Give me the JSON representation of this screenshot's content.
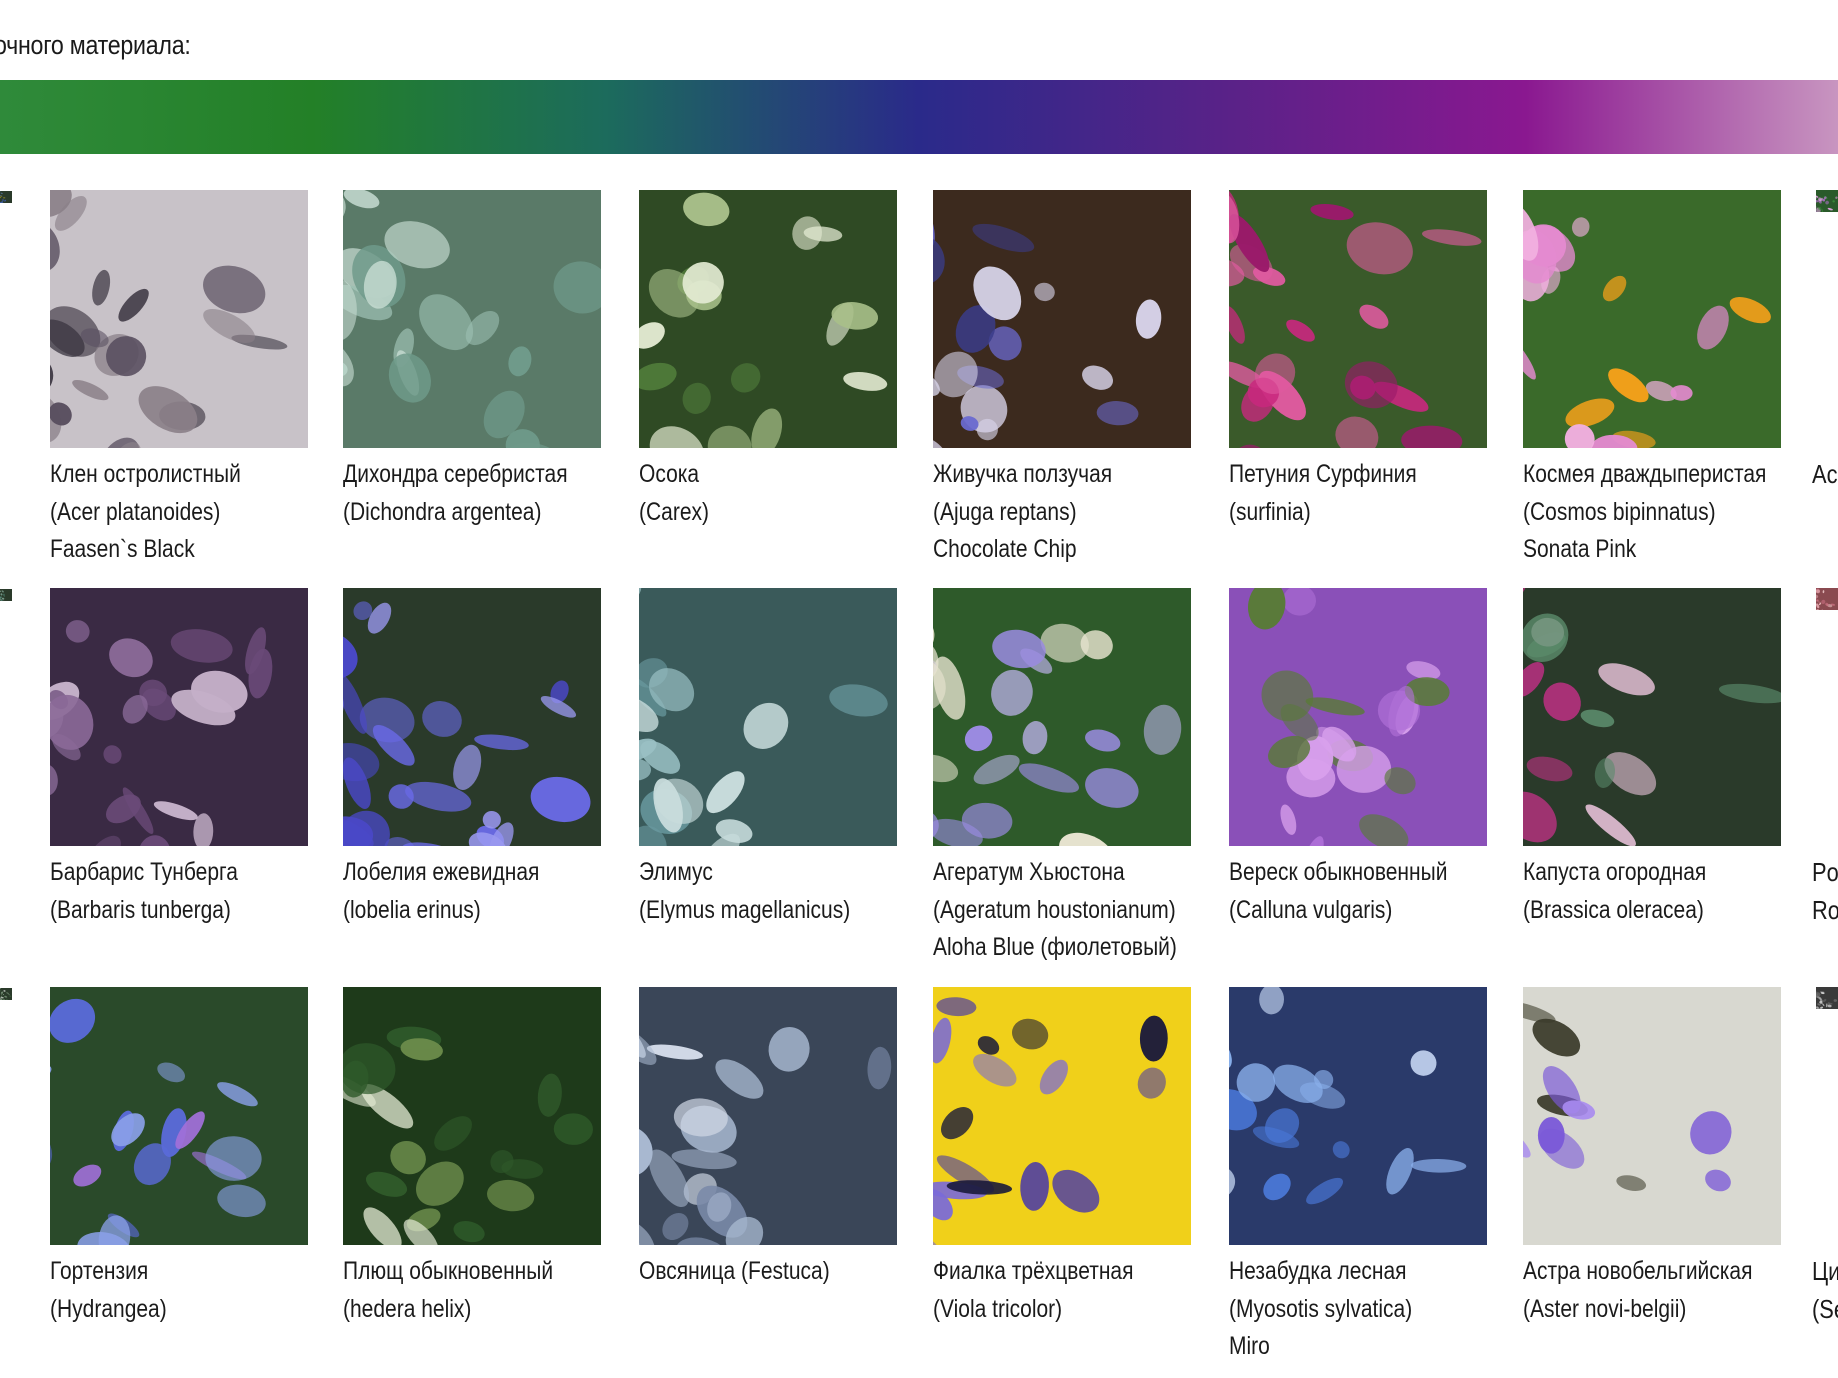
{
  "heading": "очного материала:",
  "gradient": {
    "colors": [
      "#2f8a3a",
      "#238027",
      "#1c6b5c",
      "#2a2a8a",
      "#5a2288",
      "#8a1890",
      "#c895c0"
    ]
  },
  "plants": [
    {
      "line1": "Клен остролистный",
      "line2": "(Acer platanoides)",
      "line3": "Faasen`s Black",
      "colors": [
        "#3a3440",
        "#5a5060",
        "#8a8088",
        "#c8c2c8"
      ]
    },
    {
      "line1": "Дихондра серебристая",
      "line2": "(Dichondra argentea)",
      "line3": "",
      "colors": [
        "#6f9a8a",
        "#9cc0b2",
        "#c8ddd3",
        "#5a7a68"
      ]
    },
    {
      "line1": "Осока",
      "line2": "(Carex)",
      "line3": "",
      "colors": [
        "#4f7a3a",
        "#a9c08a",
        "#e3ead2",
        "#2f4a24"
      ]
    },
    {
      "line1": "Живучка ползучая",
      "line2": "(Ajuga reptans)",
      "line3": "Chocolate Chip",
      "colors": [
        "#3a3c8a",
        "#6a6ad0",
        "#d8d4ea",
        "#3c2a1e"
      ]
    },
    {
      "line1": "Петуния Сурфиния",
      "line2": "(surfinia)",
      "line3": "",
      "colors": [
        "#9a1a6a",
        "#c8287e",
        "#e05aa0",
        "#3a5a2a"
      ]
    },
    {
      "line1": "Космея дваждыперистая",
      "line2": "(Cosmos bipinnatus)",
      "line3": "Sonata Pink",
      "colors": [
        "#e48ad0",
        "#f2b0e0",
        "#f2a01a",
        "#3a6a2a"
      ]
    },
    {
      "line1": "Барбарис Тунберга",
      "line2": "(Barbaris tunberga)",
      "line3": "",
      "colors": [
        "#6a4a78",
        "#8a6a98",
        "#c4b0c8",
        "#3a2a44"
      ]
    },
    {
      "line1": "Лобелия ежевидная",
      "line2": "(lobelia erinus)",
      "line3": "",
      "colors": [
        "#4a48c8",
        "#6a6ae8",
        "#9a98f0",
        "#2a3a2a"
      ]
    },
    {
      "line1": "Элимус",
      "line2": "(Elymus magellanicus)",
      "line3": "",
      "colors": [
        "#6a9aa0",
        "#9ac0c4",
        "#c8dcdc",
        "#3a5a5a"
      ]
    },
    {
      "line1": "Агератум Хьюстона",
      "line2": "(Ageratum houstonianum)",
      "line3": "Aloha Blue (фиолетовый)",
      "colors": [
        "#9a8ae0",
        "#c0b4f0",
        "#e8e4d0",
        "#2e5a2a"
      ]
    },
    {
      "line1": "Вереск обыкновенный",
      "line2": "(Calluna vulgaris)",
      "line3": "",
      "colors": [
        "#b070d8",
        "#d8a0ec",
        "#5a7a3a",
        "#8a50b8"
      ]
    },
    {
      "line1": "Капуста огородная",
      "line2": "(Brassica oleracea)",
      "line3": "",
      "colors": [
        "#c8308a",
        "#f0c8e0",
        "#5a8a6a",
        "#2a3a2a"
      ]
    },
    {
      "line1": "Гортензия",
      "line2": "(Hydrangea)",
      "line3": "",
      "colors": [
        "#5a6ad8",
        "#a070d8",
        "#8aa0e8",
        "#2a4a2a"
      ]
    },
    {
      "line1": "Плющ обыкновенный",
      "line2": "(hedera helix)",
      "line3": "",
      "colors": [
        "#2f5a2a",
        "#e8eed8",
        "#6a8a4a",
        "#1e3a1a"
      ]
    },
    {
      "line1": "Овсяница (Festuca)",
      "line2": "",
      "line3": "",
      "colors": [
        "#7a8aa8",
        "#a8b8d0",
        "#d0d8e6",
        "#3a4658"
      ]
    },
    {
      "line1": "Фиалка трёхцветная",
      "line2": "(Viola tricolor)",
      "line3": "",
      "colors": [
        "#4a3aa8",
        "#7a6ad8",
        "#1a1a3a",
        "#f0d01a"
      ]
    },
    {
      "line1": "Незабудка лесная",
      "line2": "(Myosotis sylvatica)",
      "line3": "Miro",
      "colors": [
        "#4a78d8",
        "#8ab0ec",
        "#c8d8f4",
        "#2a3a6a"
      ]
    },
    {
      "line1": "Астра новобельгийская",
      "line2": "(Aster novi-belgii)",
      "line3": "",
      "colors": [
        "#7a58d8",
        "#a88af0",
        "#3a3a2a",
        "#d8d8d0"
      ]
    }
  ],
  "edge_captions": [
    {
      "line1": "Ac",
      "line2": ""
    },
    {
      "line1": "Po",
      "line2": "Ro"
    },
    {
      "line1": "Ци",
      "line2": "(Se"
    }
  ]
}
